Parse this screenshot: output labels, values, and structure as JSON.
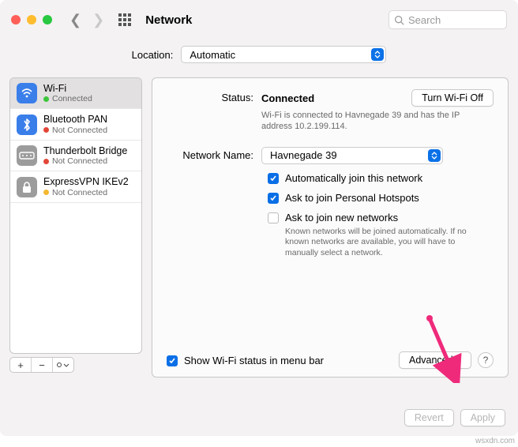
{
  "toolbar": {
    "title": "Network",
    "search_placeholder": "Search"
  },
  "location": {
    "label": "Location:",
    "value": "Automatic"
  },
  "sidebar": {
    "items": [
      {
        "name": "Wi-Fi",
        "status": "Connected",
        "dot": "green",
        "icon": "wifi",
        "selected": true
      },
      {
        "name": "Bluetooth PAN",
        "status": "Not Connected",
        "dot": "red",
        "icon": "bt",
        "selected": false
      },
      {
        "name": "Thunderbolt Bridge",
        "status": "Not Connected",
        "dot": "red",
        "icon": "tb",
        "selected": false
      },
      {
        "name": "ExpressVPN IKEv2",
        "status": "Not Connected",
        "dot": "yellow",
        "icon": "vpn",
        "selected": false
      }
    ]
  },
  "detail": {
    "status_label": "Status:",
    "status_value": "Connected",
    "turn_off_btn": "Turn Wi-Fi Off",
    "status_sub": "Wi-Fi is connected to Havnegade 39 and has the IP address 10.2.199.114.",
    "network_label": "Network Name:",
    "network_value": "Havnegade 39",
    "auto_join": "Automatically join this network",
    "ask_hotspot": "Ask to join Personal Hotspots",
    "ask_new": "Ask to join new networks",
    "ask_new_help": "Known networks will be joined automatically. If no known networks are available, you will have to manually select a network.",
    "show_menu": "Show Wi-Fi status in menu bar",
    "advanced_btn": "Advanced...",
    "help": "?"
  },
  "footer": {
    "revert": "Revert",
    "apply": "Apply"
  },
  "watermark": "wsxdn.com"
}
